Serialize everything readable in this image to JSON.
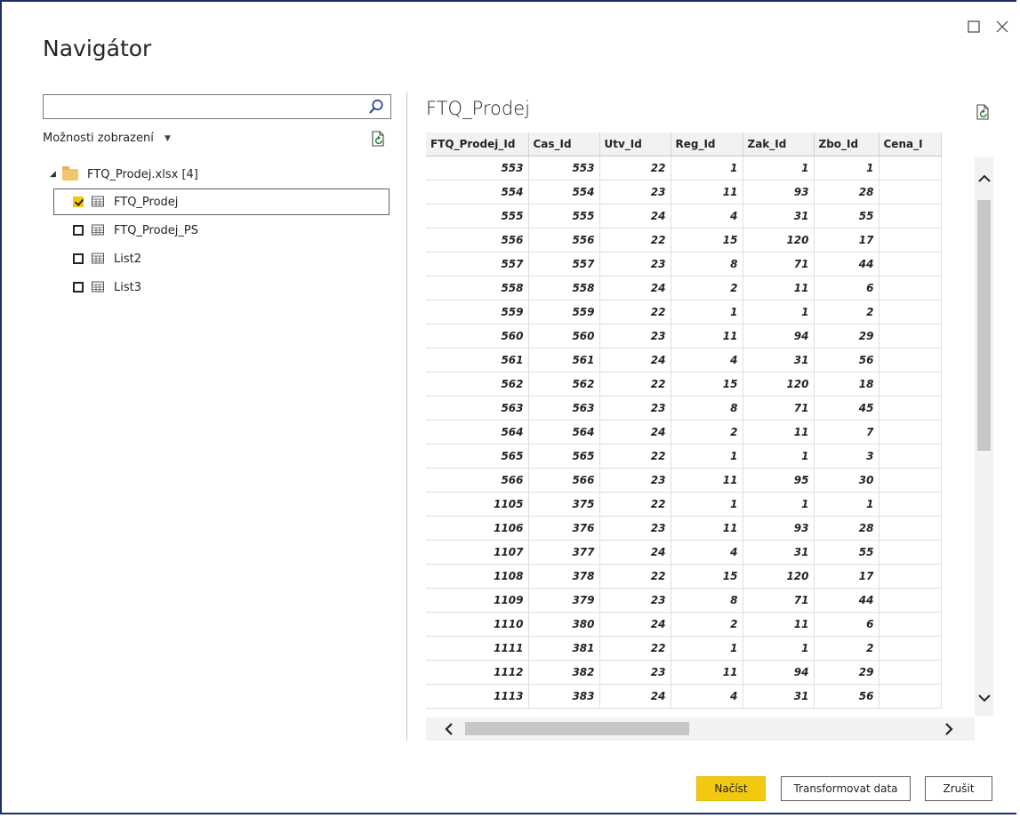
{
  "window": {
    "title": "Navigátor"
  },
  "left_pane": {
    "search": {
      "value": "",
      "placeholder": ""
    },
    "display_options_label": "Možnosti zobrazení",
    "file": {
      "name": "FTQ_Prodej.xlsx [4]"
    },
    "items": [
      {
        "label": "FTQ_Prodej",
        "checked": true,
        "selected": true
      },
      {
        "label": "FTQ_Prodej_PS",
        "checked": false,
        "selected": false
      },
      {
        "label": "List2",
        "checked": false,
        "selected": false
      },
      {
        "label": "List3",
        "checked": false,
        "selected": false
      }
    ]
  },
  "preview": {
    "title": "FTQ_Prodej",
    "columns": [
      "FTQ_Prodej_Id",
      "Cas_Id",
      "Utv_Id",
      "Reg_Id",
      "Zak_Id",
      "Zbo_Id",
      "Cena_I"
    ],
    "rows": [
      [
        "553",
        "553",
        "22",
        "1",
        "1",
        "1",
        ""
      ],
      [
        "554",
        "554",
        "23",
        "11",
        "93",
        "28",
        ""
      ],
      [
        "555",
        "555",
        "24",
        "4",
        "31",
        "55",
        ""
      ],
      [
        "556",
        "556",
        "22",
        "15",
        "120",
        "17",
        ""
      ],
      [
        "557",
        "557",
        "23",
        "8",
        "71",
        "44",
        ""
      ],
      [
        "558",
        "558",
        "24",
        "2",
        "11",
        "6",
        ""
      ],
      [
        "559",
        "559",
        "22",
        "1",
        "1",
        "2",
        ""
      ],
      [
        "560",
        "560",
        "23",
        "11",
        "94",
        "29",
        ""
      ],
      [
        "561",
        "561",
        "24",
        "4",
        "31",
        "56",
        ""
      ],
      [
        "562",
        "562",
        "22",
        "15",
        "120",
        "18",
        ""
      ],
      [
        "563",
        "563",
        "23",
        "8",
        "71",
        "45",
        ""
      ],
      [
        "564",
        "564",
        "24",
        "2",
        "11",
        "7",
        ""
      ],
      [
        "565",
        "565",
        "22",
        "1",
        "1",
        "3",
        ""
      ],
      [
        "566",
        "566",
        "23",
        "11",
        "95",
        "30",
        ""
      ],
      [
        "1105",
        "375",
        "22",
        "1",
        "1",
        "1",
        ""
      ],
      [
        "1106",
        "376",
        "23",
        "11",
        "93",
        "28",
        ""
      ],
      [
        "1107",
        "377",
        "24",
        "4",
        "31",
        "55",
        ""
      ],
      [
        "1108",
        "378",
        "22",
        "15",
        "120",
        "17",
        ""
      ],
      [
        "1109",
        "379",
        "23",
        "8",
        "71",
        "44",
        ""
      ],
      [
        "1110",
        "380",
        "24",
        "2",
        "11",
        "6",
        ""
      ],
      [
        "1111",
        "381",
        "22",
        "1",
        "1",
        "2",
        ""
      ],
      [
        "1112",
        "382",
        "23",
        "11",
        "94",
        "29",
        ""
      ],
      [
        "1113",
        "383",
        "24",
        "4",
        "31",
        "56",
        ""
      ]
    ]
  },
  "buttons": {
    "load": "Načíst",
    "transform": "Transformovat data",
    "cancel": "Zrušit"
  },
  "icons": {
    "search": "magnifier-icon",
    "refresh": "refresh-file-icon",
    "folder": "folder-icon",
    "table": "table-icon",
    "maximize": "maximize-icon",
    "close": "close-icon"
  },
  "colors": {
    "accent": "#f2c811",
    "frame": "#1e2e63",
    "folder": "#f2c46c"
  }
}
